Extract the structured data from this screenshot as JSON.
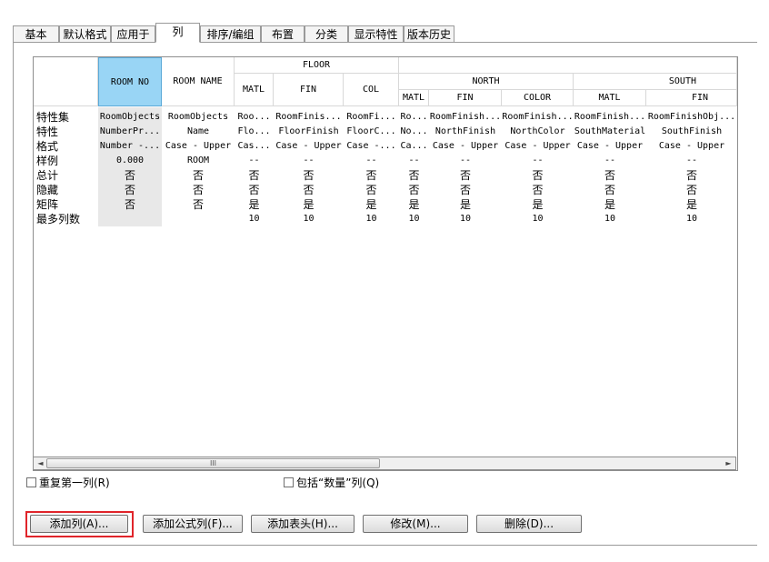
{
  "tabs": [
    "基本",
    "默认格式",
    "应用于",
    "列",
    "排序/编组",
    "布置",
    "分类",
    "显示特性",
    "版本历史"
  ],
  "headers": {
    "room_no": "ROOM NO",
    "room_name": "ROOM NAME",
    "floor": "FLOOR",
    "north": "NORTH",
    "south": "SOUTH",
    "matl": "MATL",
    "fin": "FIN",
    "col": "COL",
    "color": "COLOR"
  },
  "row_labels": [
    "特性集",
    "特性",
    "格式",
    "样例",
    "总计",
    "隐藏",
    "矩阵",
    "最多列数"
  ],
  "columns": [
    [
      "RoomObjects",
      "NumberPr...",
      "Number -...",
      "0.000",
      "否",
      "否",
      "否",
      ""
    ],
    [
      "RoomObjects",
      "Name",
      "Case - Upper",
      "ROOM",
      "否",
      "否",
      "否",
      ""
    ],
    [
      "Roo...",
      "Flo...",
      "Cas...",
      "--",
      "否",
      "否",
      "是",
      "10"
    ],
    [
      "RoomFinis...",
      "FloorFinish",
      "Case - Upper",
      "--",
      "否",
      "否",
      "是",
      "10"
    ],
    [
      "RoomFi...",
      "FloorC...",
      "Case -...",
      "--",
      "否",
      "否",
      "是",
      "10"
    ],
    [
      "Ro...",
      "No...",
      "Ca...",
      "--",
      "否",
      "否",
      "是",
      "10"
    ],
    [
      "RoomFinish...",
      "NorthFinish",
      "Case - Upper",
      "--",
      "否",
      "否",
      "是",
      "10"
    ],
    [
      "RoomFinish...",
      "NorthColor",
      "Case - Upper",
      "--",
      "否",
      "否",
      "是",
      "10"
    ],
    [
      "RoomFinish...",
      "SouthMaterial",
      "Case - Upper",
      "--",
      "否",
      "否",
      "是",
      "10"
    ],
    [
      "RoomFinishObj...",
      "SouthFinish",
      "Case - Upper",
      "--",
      "否",
      "否",
      "是",
      "10"
    ]
  ],
  "scrollbar": {
    "left_arrow": "◄",
    "right_arrow": "►",
    "thumb_grip": "III"
  },
  "checkboxes": {
    "repeat_first_column": "重复第一列(R)",
    "include_quantity": "包括“数量”列(Q)"
  },
  "buttons": {
    "add_column": "添加列(A)...",
    "add_formula_column": "添加公式列(F)...",
    "add_header": "添加表头(H)...",
    "modify": "修改(M)...",
    "delete": "删除(D)..."
  },
  "colors": {
    "highlight": "#e0242a",
    "selected_header": "#99d5f5"
  }
}
